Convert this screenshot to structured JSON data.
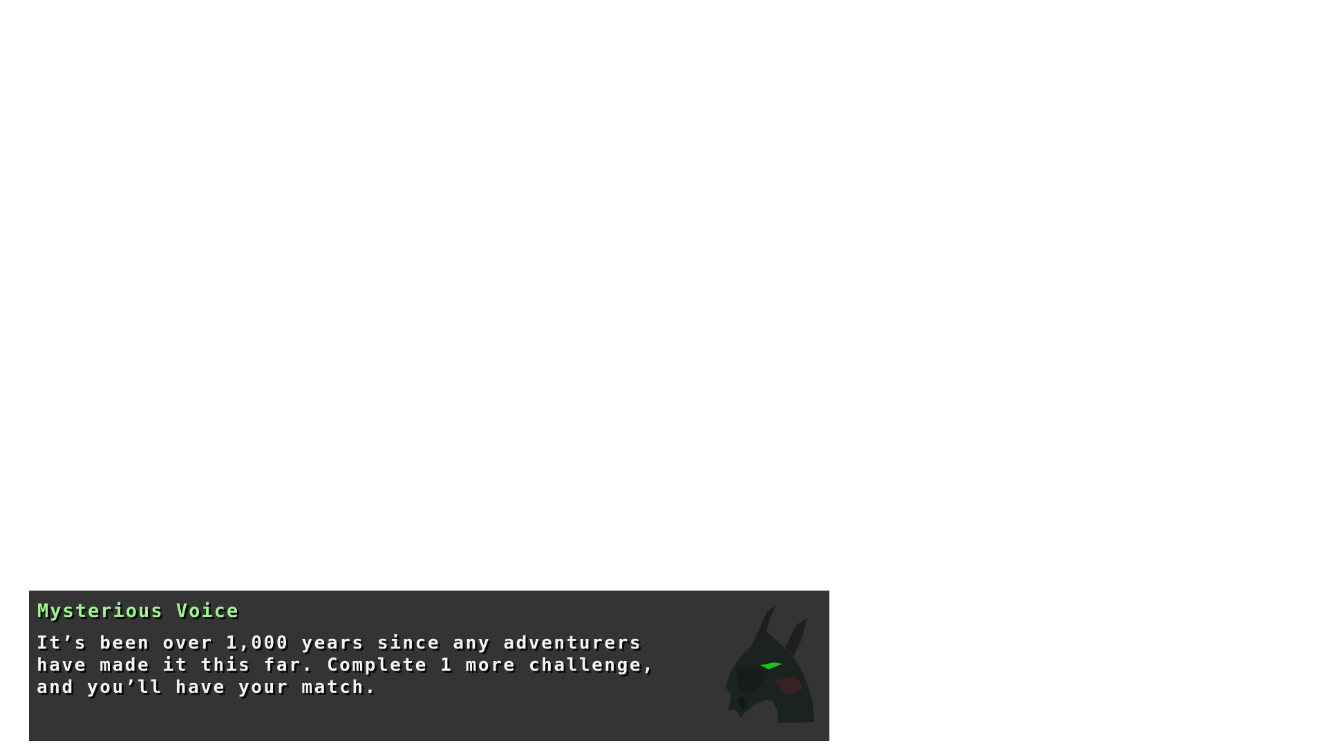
{
  "dialog": {
    "speaker": "Mysterious Voice",
    "lines": [
      "It’s been over 1,000 years since any adventurers",
      "have made it this far. Complete 1 more challenge,",
      "and you’ll have your match."
    ],
    "speaker_color": "#9ff58f",
    "text_color": "#f4f4f4",
    "box_color": "#343434",
    "portrait_icon": "dragon-head-icon",
    "portrait_eye_color": "#1fbf1f"
  }
}
